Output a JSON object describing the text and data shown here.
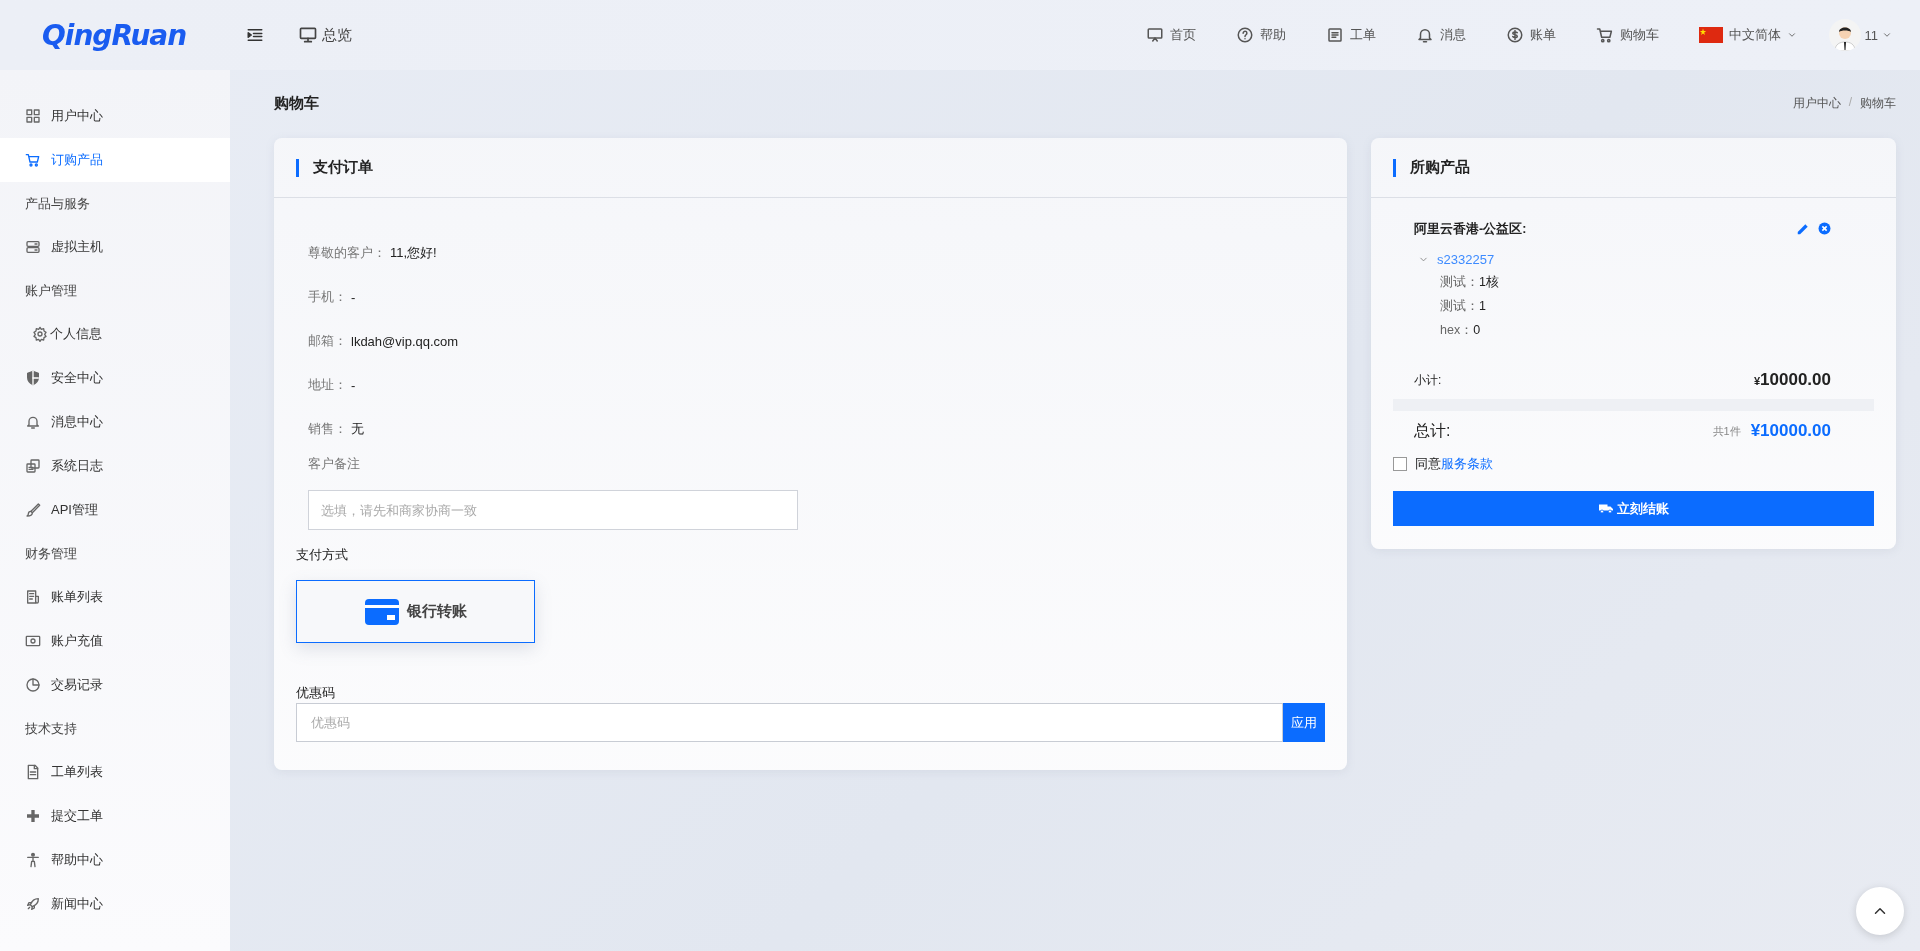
{
  "header": {
    "logo": "QingRuan",
    "overview": "总览",
    "nav": [
      "首页",
      "帮助",
      "工单",
      "消息",
      "账单",
      "购物车"
    ],
    "language": "中文简体",
    "user": "11"
  },
  "sidebar": {
    "items": [
      {
        "kind": "item",
        "label": "用户中心",
        "selected": false
      },
      {
        "kind": "item",
        "label": "订购产品",
        "selected": true
      },
      {
        "kind": "section",
        "label": "产品与服务"
      },
      {
        "kind": "item",
        "label": "虚拟主机",
        "selected": false
      },
      {
        "kind": "section",
        "label": "账户管理"
      },
      {
        "kind": "item",
        "label": "个人信息",
        "selected": false
      },
      {
        "kind": "item",
        "label": "安全中心",
        "selected": false
      },
      {
        "kind": "item",
        "label": "消息中心",
        "selected": false
      },
      {
        "kind": "item",
        "label": "系统日志",
        "selected": false
      },
      {
        "kind": "item",
        "label": "API管理",
        "selected": false
      },
      {
        "kind": "section",
        "label": "财务管理"
      },
      {
        "kind": "item",
        "label": "账单列表",
        "selected": false
      },
      {
        "kind": "item",
        "label": "账户充值",
        "selected": false
      },
      {
        "kind": "item",
        "label": "交易记录",
        "selected": false
      },
      {
        "kind": "section",
        "label": "技术支持"
      },
      {
        "kind": "item",
        "label": "工单列表",
        "selected": false
      },
      {
        "kind": "item",
        "label": "提交工单",
        "selected": false
      },
      {
        "kind": "item",
        "label": "帮助中心",
        "selected": false
      },
      {
        "kind": "item",
        "label": "新闻中心",
        "selected": false
      }
    ]
  },
  "page": {
    "title": "购物车",
    "breadcrumb": [
      "用户中心",
      "购物车"
    ],
    "separator": "/"
  },
  "order": {
    "title": "支付订单",
    "fields": [
      {
        "label": "尊敬的客户：",
        "value": "11,您好!"
      },
      {
        "label": "手机：",
        "value": "-"
      },
      {
        "label": "邮箱：",
        "value": "lkdah@vip.qq.com"
      },
      {
        "label": "地址：",
        "value": "-"
      },
      {
        "label": "销售：",
        "value": "无"
      }
    ],
    "note": {
      "label": "客户备注",
      "placeholder": "选填，请先和商家协商一致"
    },
    "payment": {
      "label": "支付方式",
      "methods": [
        {
          "label": "银行转账",
          "selected": true
        }
      ]
    },
    "coupon": {
      "label": "优惠码",
      "placeholder": "优惠码",
      "button": "应用"
    }
  },
  "cart": {
    "title": "所购产品",
    "products": [
      {
        "name": "阿里云香港-公益区:",
        "item": "s2332257",
        "expanded": true,
        "specs": [
          {
            "label": "测试：",
            "value": "1核"
          },
          {
            "label": "测试：",
            "value": "1"
          },
          {
            "label": "hex：",
            "value": "0"
          }
        ]
      }
    ],
    "subtotal": {
      "label": "小计:",
      "currency": "¥",
      "amount": "10000.00"
    },
    "total": {
      "label": "总计:",
      "count": "共1件",
      "amount": "¥10000.00"
    },
    "agree": {
      "checked": false,
      "text": "同意",
      "link": "服务条款"
    },
    "checkout": "立刻结账"
  }
}
